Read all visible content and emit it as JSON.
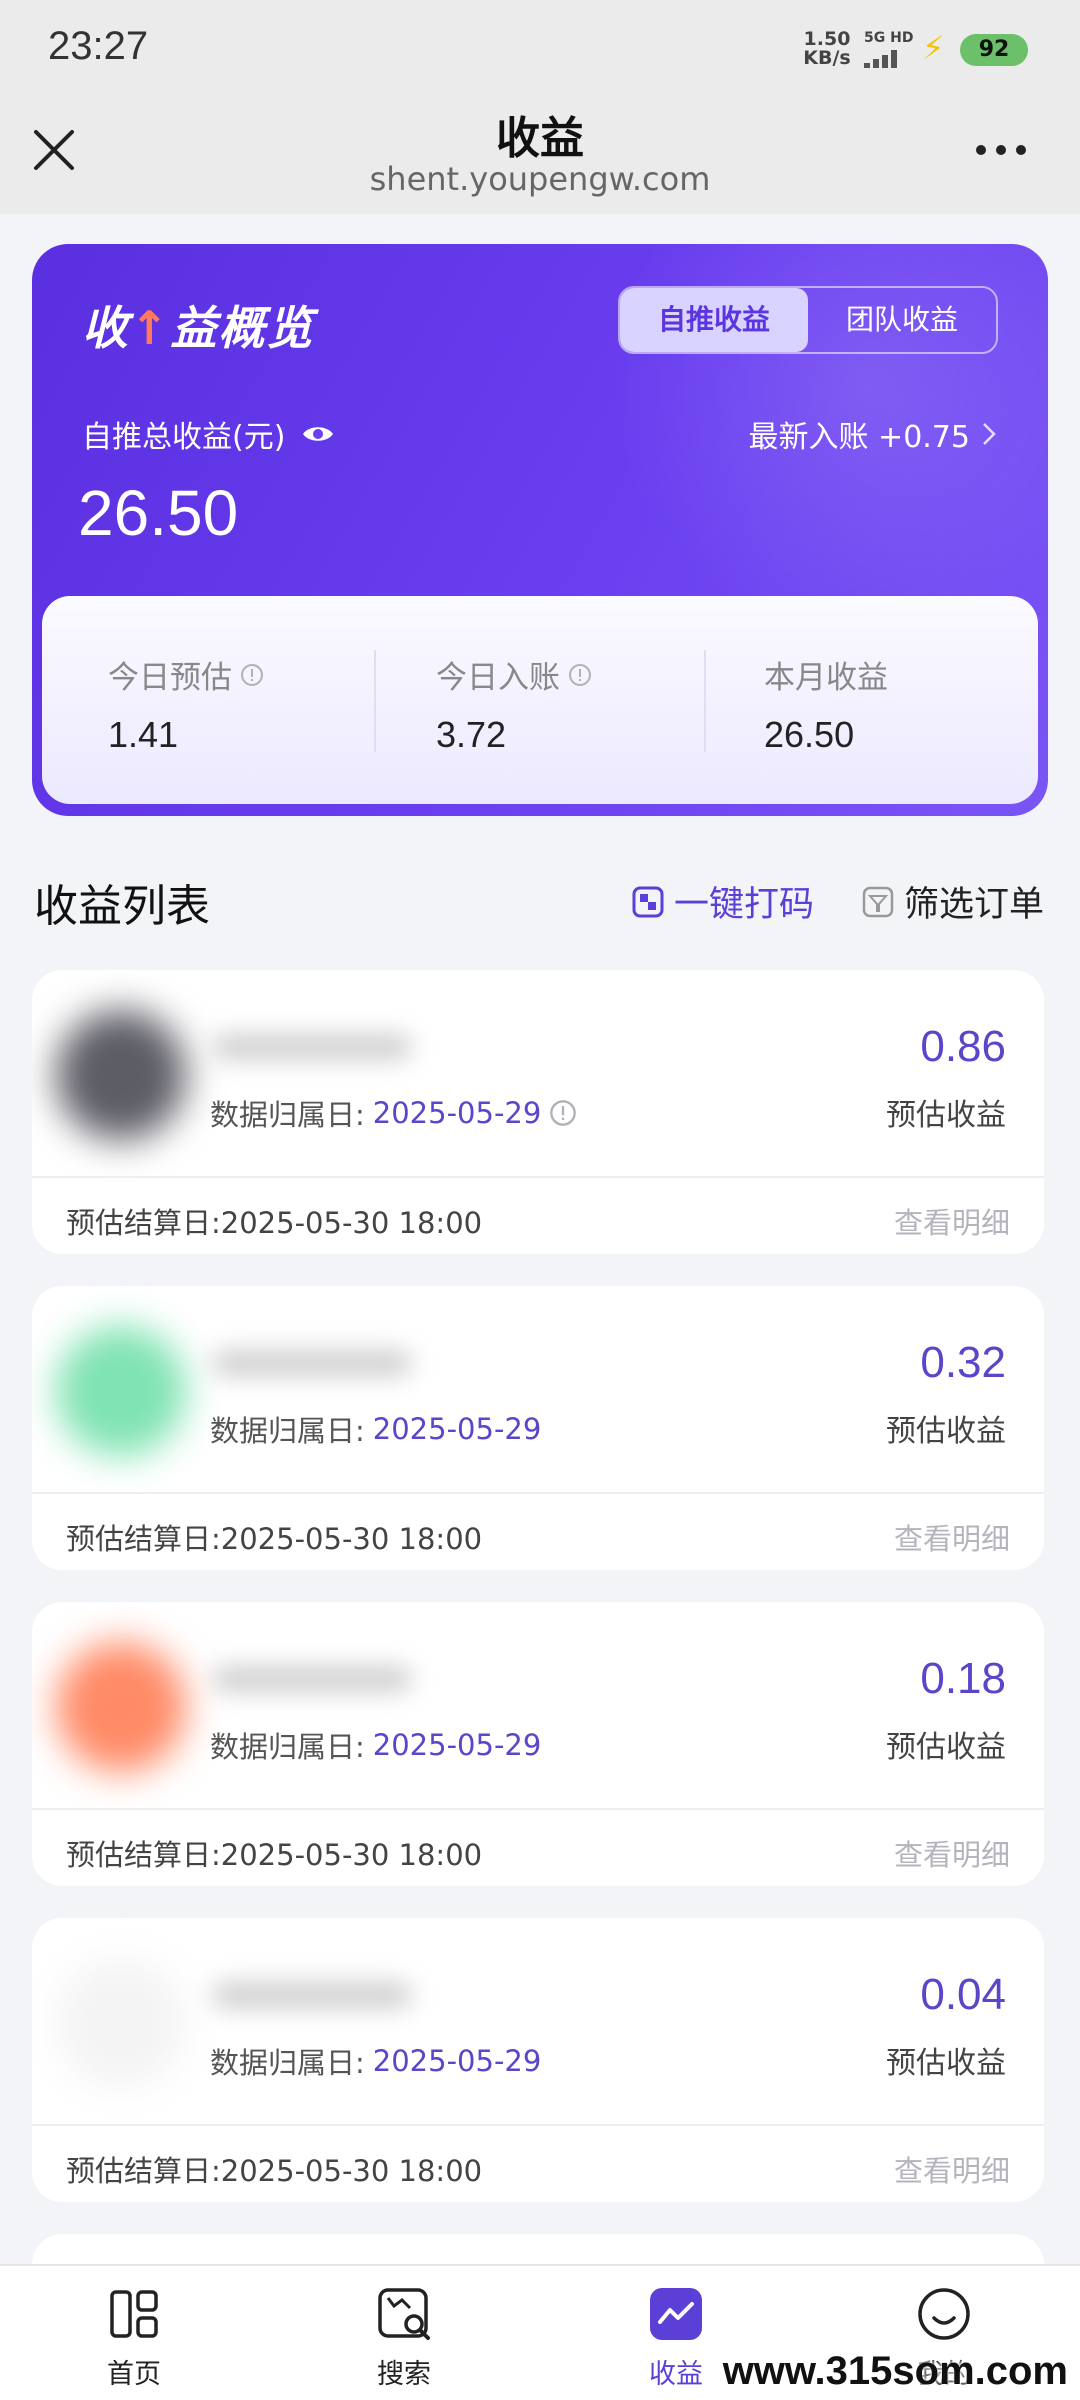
{
  "status_bar": {
    "time": "23:27",
    "net_speed_value": "1.50",
    "net_speed_unit": "KB/s",
    "signal_label": "5G HD",
    "battery": "92"
  },
  "header": {
    "title": "收益",
    "url": "shent.youpengw.com"
  },
  "overview": {
    "title_accent": "收",
    "title_rest": "益概览",
    "tabs": [
      "自推收益",
      "团队收益"
    ],
    "active_tab": "自推收益",
    "total_label": "自推总收益(元)",
    "total_value": "26.50",
    "latest_label": "最新入账 +0.75",
    "stats": [
      {
        "label": "今日预估",
        "value": "1.41"
      },
      {
        "label": "今日入账",
        "value": "3.72"
      },
      {
        "label": "本月收益",
        "value": "26.50"
      }
    ]
  },
  "list": {
    "title": "收益列表",
    "print_label": "一键打码",
    "filter_label": "筛选订单",
    "records": [
      {
        "date_label": "数据归属日:",
        "date": "2025-05-29",
        "amount": "0.86",
        "amount_label": "预估收益",
        "settle": "预估结算日:2025-05-30 18:00",
        "detail": "查看明细"
      },
      {
        "date_label": "数据归属日:",
        "date": "2025-05-29",
        "amount": "0.32",
        "amount_label": "预估收益",
        "settle": "预估结算日:2025-05-30 18:00",
        "detail": "查看明细"
      },
      {
        "date_label": "数据归属日:",
        "date": "2025-05-29",
        "amount": "0.18",
        "amount_label": "预估收益",
        "settle": "预估结算日:2025-05-30 18:00",
        "detail": "查看明细"
      },
      {
        "date_label": "数据归属日:",
        "date": "2025-05-29",
        "amount": "0.04",
        "amount_label": "预估收益",
        "settle": "预估结算日:2025-05-30 18:00",
        "detail": "查看明细"
      }
    ]
  },
  "tabbar": {
    "items": [
      {
        "label": "首页",
        "icon": "home-grid-icon"
      },
      {
        "label": "搜索",
        "icon": "search-icon"
      },
      {
        "label": "收益",
        "icon": "earnings-chart-icon"
      },
      {
        "label": "我的",
        "icon": "profile-smile-icon"
      }
    ],
    "active": "收益"
  },
  "watermark": "www.315som.com",
  "colors": {
    "brand": "#5b3fd6",
    "card_gradient_start": "#5a2fe0",
    "card_gradient_end": "#7a55f5",
    "amount": "#5b45c9"
  }
}
